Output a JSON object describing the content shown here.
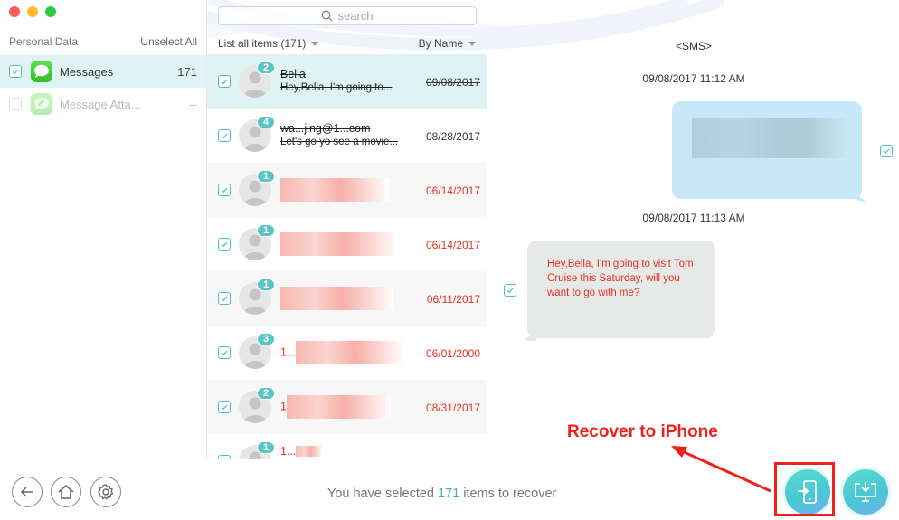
{
  "window": {
    "controls": [
      "close",
      "minimize",
      "zoom"
    ]
  },
  "sidebar": {
    "header_label": "Personal Data",
    "unselect_all_label": "Unselect All",
    "items": [
      {
        "label": "Messages",
        "count": "171",
        "checked": true,
        "active": true,
        "icon": "messages-icon"
      },
      {
        "label": "Message Atta...",
        "count": "--",
        "checked": false,
        "active": false,
        "icon": "message-attachment-icon"
      }
    ]
  },
  "list": {
    "search_placeholder": "search",
    "filter_label": "List all items (171)",
    "sort_label": "By Name",
    "rows": [
      {
        "badge": "2",
        "name": "Bella",
        "snippet": "Hey,Bella, I'm going to...",
        "date": "09/08/2017",
        "deleted": true,
        "active": true,
        "checked": true
      },
      {
        "badge": "4",
        "name": "wa...jing@1...com",
        "snippet": "Let's go yo see a movie...",
        "date": "08/28/2017",
        "deleted": true,
        "active": false,
        "checked": true
      },
      {
        "badge": "1",
        "name": "",
        "snippet": "",
        "date": "06/14/2017",
        "deleted": false,
        "active": false,
        "checked": true
      },
      {
        "badge": "1",
        "name": "",
        "snippet": "",
        "date": "06/14/2017",
        "deleted": false,
        "active": false,
        "checked": true
      },
      {
        "badge": "1",
        "name": "",
        "snippet": "",
        "date": "06/11/2017",
        "deleted": false,
        "active": false,
        "checked": true
      },
      {
        "badge": "3",
        "name": "1...",
        "snippet": "",
        "date": "06/01/2000",
        "deleted": false,
        "active": false,
        "checked": true
      },
      {
        "badge": "2",
        "name": "1",
        "snippet": "",
        "date": "08/31/2017",
        "deleted": false,
        "active": false,
        "checked": true
      },
      {
        "badge": "1",
        "name": "1...",
        "snippet": "",
        "date": "",
        "deleted": false,
        "active": false,
        "checked": true
      }
    ]
  },
  "conversation": {
    "title": "<SMS>",
    "messages": [
      {
        "timestamp": "09/08/2017 11:12 AM",
        "direction": "outgoing",
        "text": "",
        "checked": true
      },
      {
        "timestamp": "09/08/2017 11:13 AM",
        "direction": "incoming",
        "text": "Hey,Bella, I'm going to visit Tom Cruise this Saturday, will you want to go with me?",
        "checked": true
      }
    ]
  },
  "bottom": {
    "status_prefix": "You have selected ",
    "status_count": "171",
    "status_suffix": " items to recover",
    "buttons": {
      "back": "back-icon",
      "home": "home-icon",
      "settings": "gear-icon",
      "recover_to_device": "recover-to-device-icon",
      "recover_to_computer": "recover-to-computer-icon"
    }
  },
  "annotation": {
    "label": "Recover to iPhone",
    "color": "#f0201a"
  },
  "colors": {
    "accent": "#4ec3bd",
    "active_row": "#dff3f2",
    "badge": "#5bc4c4",
    "deleted_red": "#e8321f",
    "bubble_out": "#c7e8f9",
    "bubble_in": "#e7e9e9"
  }
}
